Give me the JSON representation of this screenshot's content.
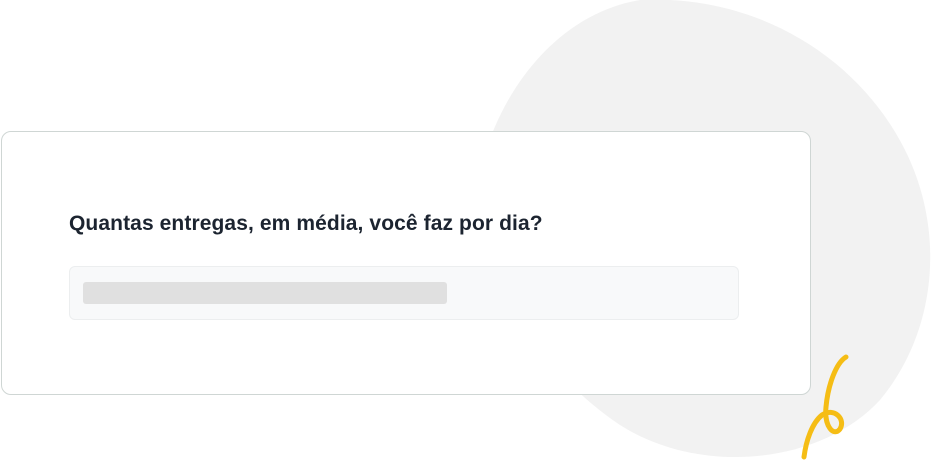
{
  "form": {
    "question": "Quantas entregas, em média, você faz por dia?",
    "answer_value": ""
  },
  "colors": {
    "accent_squiggle": "#f5bd15",
    "blob": "#f2f2f2",
    "text": "#1c2430",
    "card_border": "#cfd6d4"
  },
  "decorations": {
    "background_shape": "blob",
    "accent_shape": "squiggle-icon"
  }
}
